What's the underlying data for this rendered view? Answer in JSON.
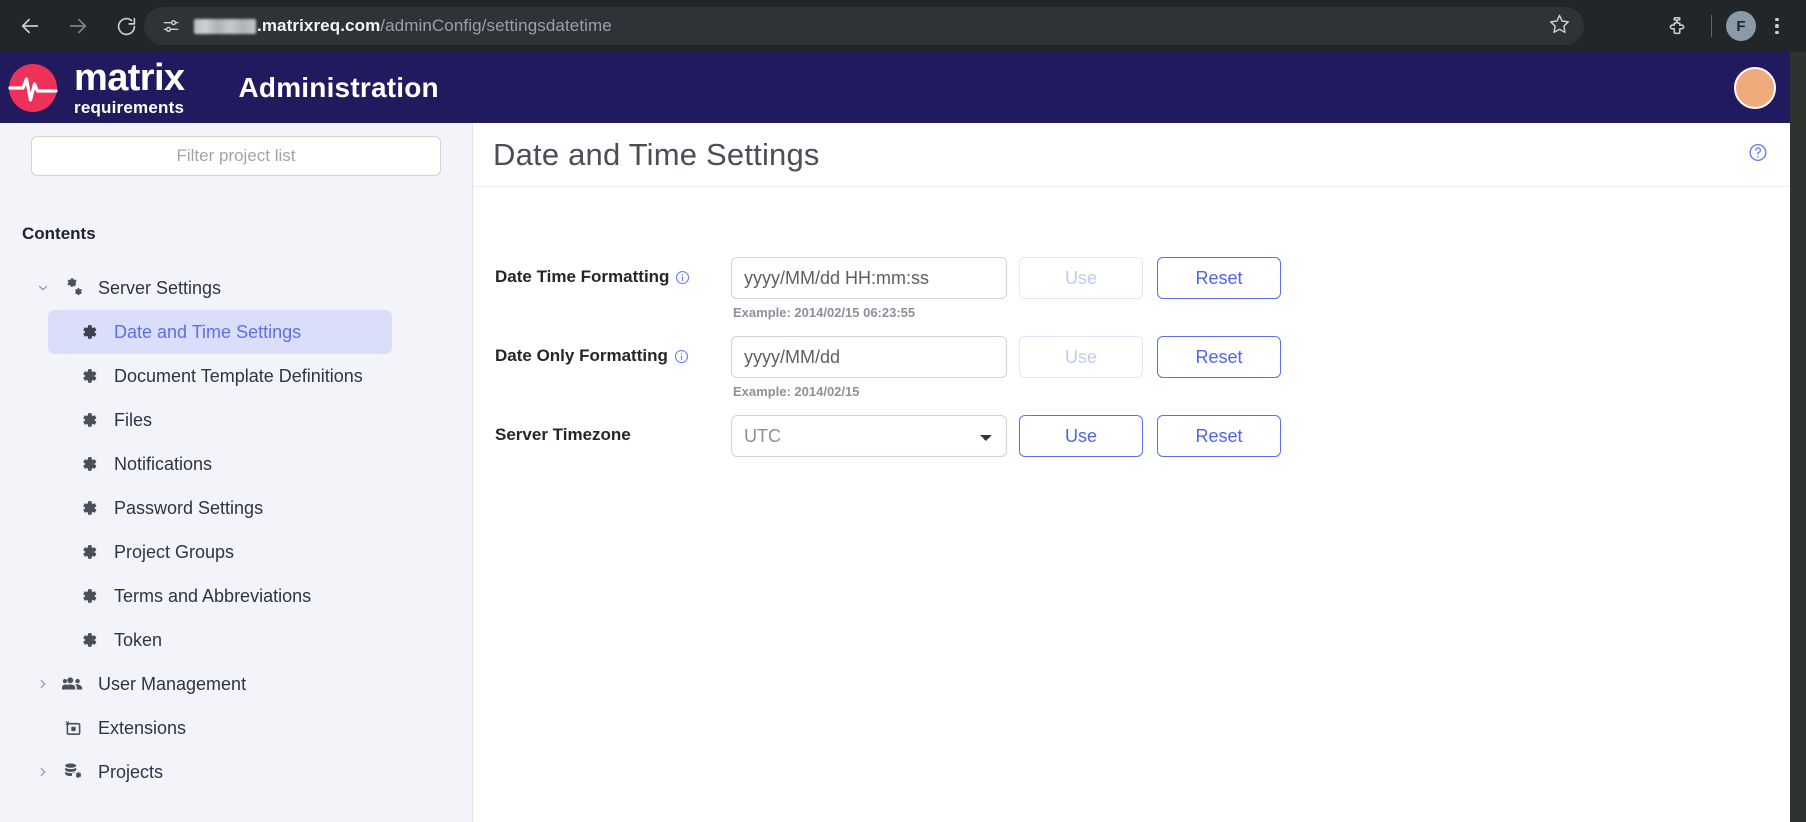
{
  "browser": {
    "back_icon": "back-arrow-icon",
    "forward_icon": "forward-arrow-icon",
    "reload_icon": "reload-icon",
    "site_info_icon": "site-settings-icon",
    "url_host": ".matrixreq.com",
    "url_path": "/adminConfig/settingsdatetime",
    "bookmark_icon": "star-icon",
    "extensions_icon": "puzzle-icon",
    "profile_initial": "F",
    "menu_icon": "kebab-menu-icon"
  },
  "app_header": {
    "logo_line1": "matrix",
    "logo_line2": "requirements",
    "title": "Administration",
    "avatar": "user-avatar"
  },
  "sidebar": {
    "filter_placeholder": "Filter project list",
    "filter_value": "",
    "contents_heading": "Contents",
    "items": [
      {
        "label": "Server Settings",
        "level": 0,
        "icon": "server-settings-icon",
        "caret": "chevron-down",
        "active": false
      },
      {
        "label": "Date and Time Settings",
        "level": 1,
        "icon": "gear-icon",
        "caret": "",
        "active": true
      },
      {
        "label": "Document Template Definitions",
        "level": 1,
        "icon": "gear-icon",
        "caret": "",
        "active": false
      },
      {
        "label": "Files",
        "level": 1,
        "icon": "gear-icon",
        "caret": "",
        "active": false
      },
      {
        "label": "Notifications",
        "level": 1,
        "icon": "gear-icon",
        "caret": "",
        "active": false
      },
      {
        "label": "Password Settings",
        "level": 1,
        "icon": "gear-icon",
        "caret": "",
        "active": false
      },
      {
        "label": "Project Groups",
        "level": 1,
        "icon": "gear-icon",
        "caret": "",
        "active": false
      },
      {
        "label": "Terms and Abbreviations",
        "level": 1,
        "icon": "gear-icon",
        "caret": "",
        "active": false
      },
      {
        "label": "Token",
        "level": 1,
        "icon": "gear-icon",
        "caret": "",
        "active": false
      },
      {
        "label": "User Management",
        "level": 0,
        "icon": "users-icon",
        "caret": "chevron-right",
        "active": false
      },
      {
        "label": "Extensions",
        "level": 0,
        "icon": "extensions-icon",
        "caret": "",
        "active": false
      },
      {
        "label": "Projects",
        "level": 0,
        "icon": "database-gear-icon",
        "caret": "chevron-right",
        "active": false
      }
    ]
  },
  "main": {
    "page_title": "Date and Time Settings",
    "help_icon": "help-circle-icon",
    "rows": [
      {
        "label": "Date Time Formatting",
        "has_info": true,
        "control": "text",
        "value": "",
        "placeholder": "yyyy/MM/dd HH:mm:ss",
        "example": "Example: 2014/02/15 06:23:55",
        "use_label": "Use",
        "use_enabled": false,
        "reset_label": "Reset",
        "reset_enabled": true
      },
      {
        "label": "Date Only Formatting",
        "has_info": true,
        "control": "text",
        "value": "",
        "placeholder": "yyyy/MM/dd",
        "example": "Example: 2014/02/15",
        "use_label": "Use",
        "use_enabled": false,
        "reset_label": "Reset",
        "reset_enabled": true
      },
      {
        "label": "Server Timezone",
        "has_info": false,
        "control": "select",
        "value": "UTC",
        "placeholder": "",
        "example": "",
        "use_label": "Use",
        "use_enabled": true,
        "reset_label": "Reset",
        "reset_enabled": true
      }
    ]
  },
  "colors": {
    "header_navy": "#211a5e",
    "logo_pink": "#ee3158",
    "accent_blue": "#5b6ef0",
    "active_nav_bg": "#dbdefa",
    "sidebar_bg": "#f2f4f9",
    "avatar_peach": "#efab7b"
  }
}
